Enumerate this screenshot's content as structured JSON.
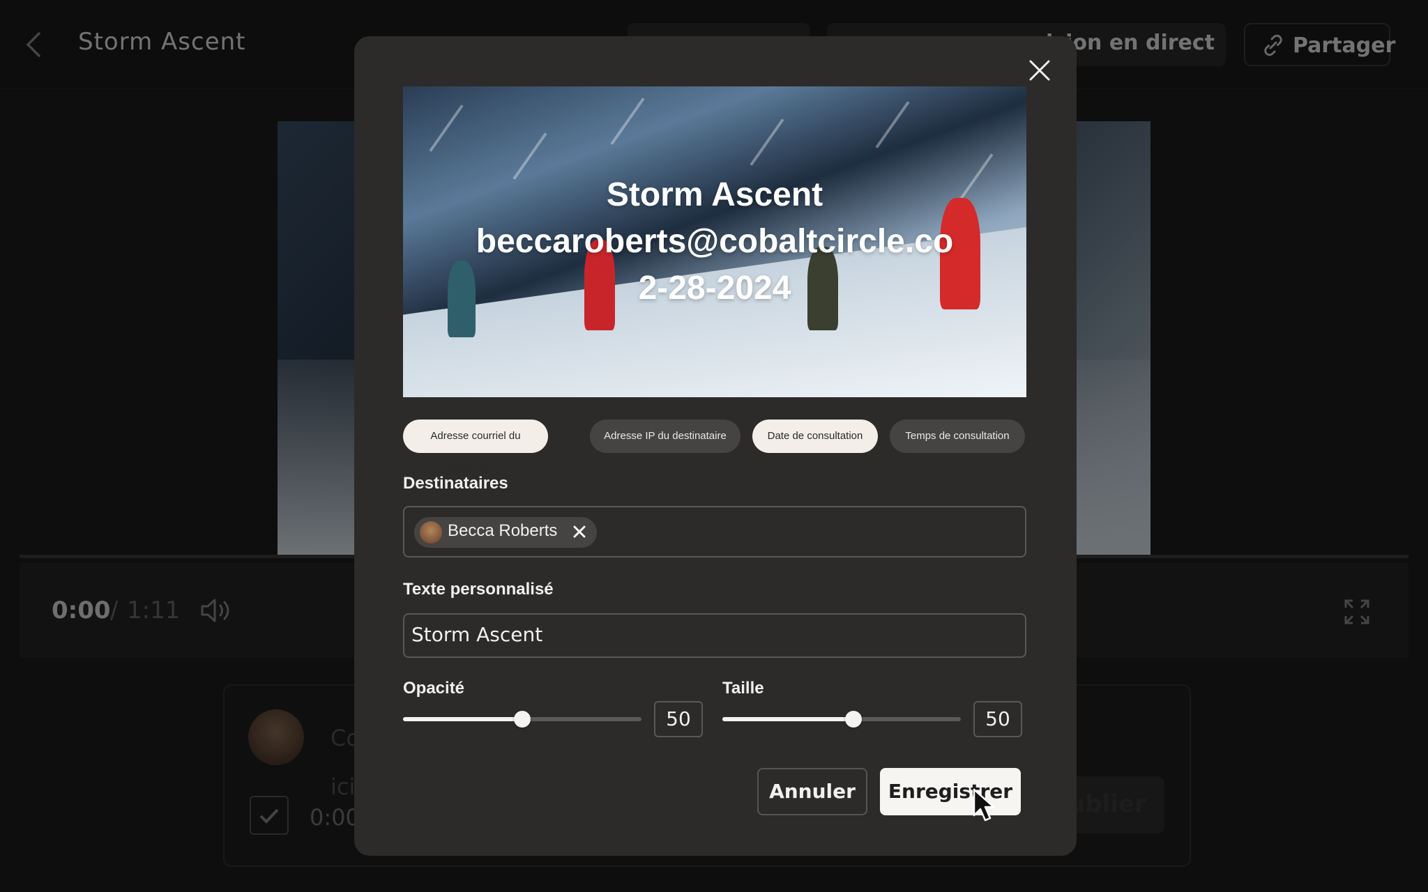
{
  "header": {
    "title": "Storm Ascent",
    "live_review_label": "ision en direct",
    "share_label": "Partager"
  },
  "player": {
    "current_time": "0:00",
    "separator": "/",
    "duration": "1:11"
  },
  "comment_box": {
    "placeholder_start": "Co",
    "placeholder_line2": "ici",
    "timestamp": "0:00",
    "publish_label": "ublier"
  },
  "modal": {
    "preview": {
      "watermark_lines": [
        "Storm Ascent",
        "beccaroberts@cobaltcircle.co",
        "2-28-2024"
      ]
    },
    "chips": [
      {
        "label": "Adresse courriel du destinataire",
        "selected": true
      },
      {
        "label": "Adresse IP du destinataire",
        "selected": false
      },
      {
        "label": "Date de consultation",
        "selected": true
      },
      {
        "label": "Temps de consultation",
        "selected": false
      }
    ],
    "recipients": {
      "label": "Destinataires",
      "tags": [
        {
          "name": "Becca Roberts"
        }
      ]
    },
    "custom_text": {
      "label": "Texte personnalisé",
      "value": "Storm Ascent"
    },
    "opacity": {
      "label": "Opacité",
      "value": "50",
      "fraction": 0.5
    },
    "size": {
      "label": "Taille",
      "value": "50",
      "fraction": 0.55
    },
    "cancel_label": "Annuler",
    "save_label": "Enregistrer"
  },
  "colors": {
    "modal_bg": "#2c2b2a",
    "chip_selected": "#f3efe8",
    "chip_unselected": "#454442",
    "primary_button": "#f7f5f2"
  }
}
